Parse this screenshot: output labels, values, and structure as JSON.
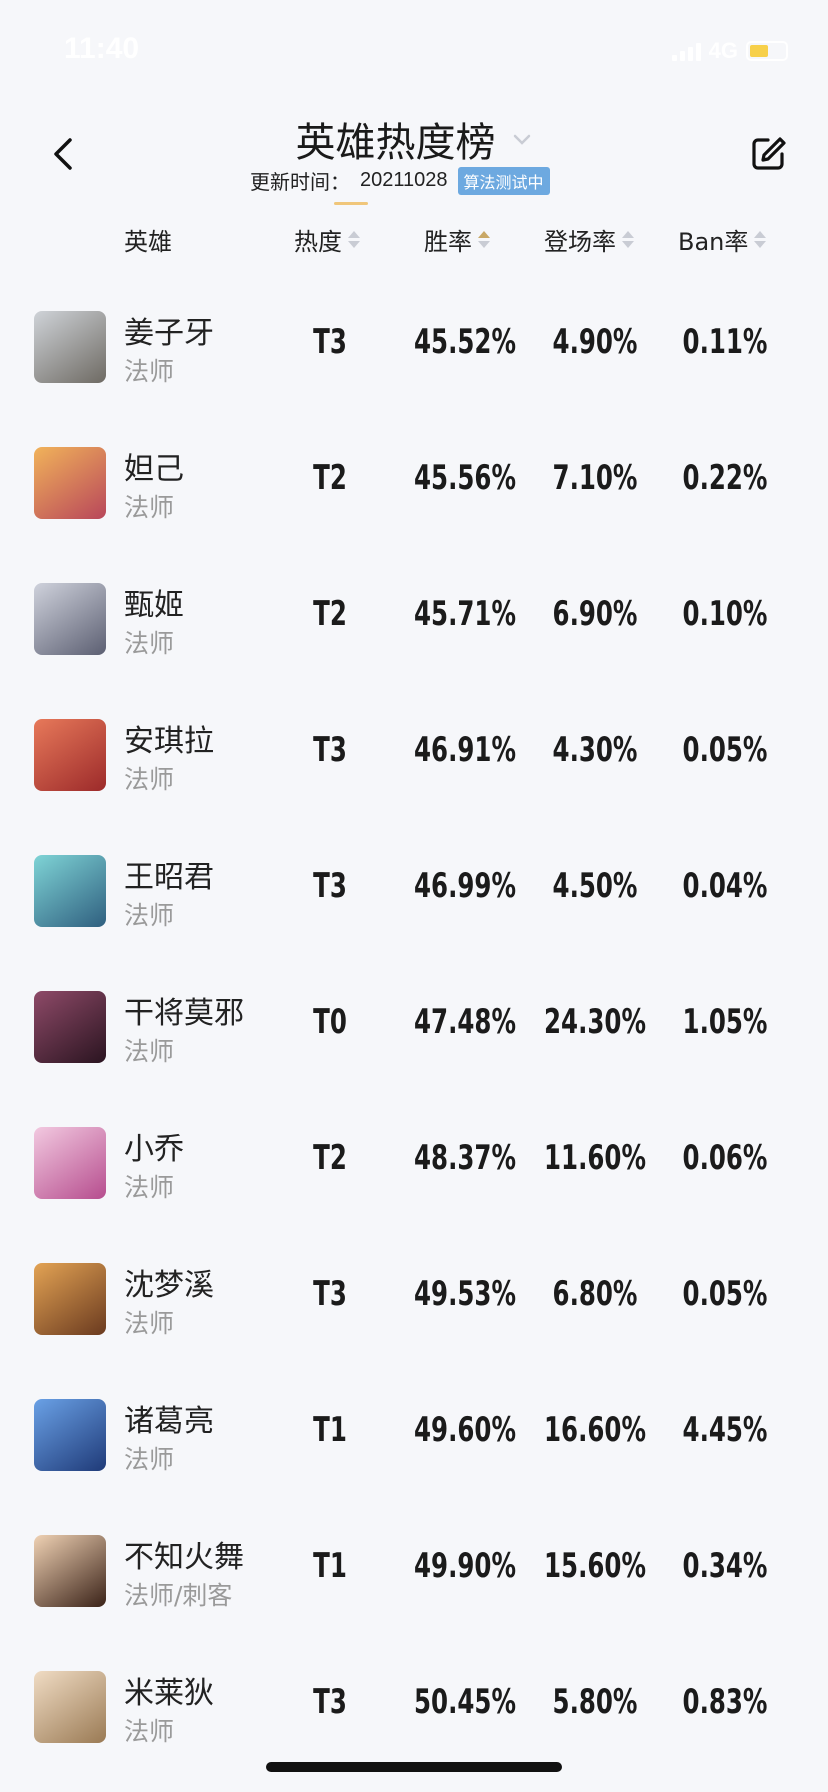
{
  "status_bar": {
    "time": "11:40",
    "network": "4G"
  },
  "nav": {
    "title": "英雄热度榜",
    "update_label": "更新时间：",
    "update_date": "20211028",
    "badge": "算法测试中"
  },
  "columns": {
    "hero": "英雄",
    "heat": "热度",
    "win_rate": "胜率",
    "pick_rate": "登场率",
    "ban_rate": "Ban率"
  },
  "active_sort": "win_rate",
  "heroes": [
    {
      "name": "姜子牙",
      "role": "法师",
      "tier": "T3",
      "win_rate": "45.52%",
      "pick_rate": "4.90%",
      "ban_rate": "0.11%",
      "color_a": "#cfd3d8",
      "color_b": "#6e6a63"
    },
    {
      "name": "妲己",
      "role": "法师",
      "tier": "T2",
      "win_rate": "45.56%",
      "pick_rate": "7.10%",
      "ban_rate": "0.22%",
      "color_a": "#f1b35a",
      "color_b": "#b8465a"
    },
    {
      "name": "甄姬",
      "role": "法师",
      "tier": "T2",
      "win_rate": "45.71%",
      "pick_rate": "6.90%",
      "ban_rate": "0.10%",
      "color_a": "#cfd2dc",
      "color_b": "#5c5f72"
    },
    {
      "name": "安琪拉",
      "role": "法师",
      "tier": "T3",
      "win_rate": "46.91%",
      "pick_rate": "4.30%",
      "ban_rate": "0.05%",
      "color_a": "#e7795a",
      "color_b": "#9c2a2a"
    },
    {
      "name": "王昭君",
      "role": "法师",
      "tier": "T3",
      "win_rate": "46.99%",
      "pick_rate": "4.50%",
      "ban_rate": "0.04%",
      "color_a": "#7fd4d6",
      "color_b": "#2f5f7f"
    },
    {
      "name": "干将莫邪",
      "role": "法师",
      "tier": "T0",
      "win_rate": "47.48%",
      "pick_rate": "24.30%",
      "ban_rate": "1.05%",
      "color_a": "#8e4a68",
      "color_b": "#2a1420"
    },
    {
      "name": "小乔",
      "role": "法师",
      "tier": "T2",
      "win_rate": "48.37%",
      "pick_rate": "11.60%",
      "ban_rate": "0.06%",
      "color_a": "#f2c9e0",
      "color_b": "#b64d8e"
    },
    {
      "name": "沈梦溪",
      "role": "法师",
      "tier": "T3",
      "win_rate": "49.53%",
      "pick_rate": "6.80%",
      "ban_rate": "0.05%",
      "color_a": "#e3a354",
      "color_b": "#6a3a1f"
    },
    {
      "name": "诸葛亮",
      "role": "法师",
      "tier": "T1",
      "win_rate": "49.60%",
      "pick_rate": "16.60%",
      "ban_rate": "4.45%",
      "color_a": "#6aa1e6",
      "color_b": "#1f3a78"
    },
    {
      "name": "不知火舞",
      "role": "法师/刺客",
      "tier": "T1",
      "win_rate": "49.90%",
      "pick_rate": "15.60%",
      "ban_rate": "0.34%",
      "color_a": "#f0d2b4",
      "color_b": "#3a2218"
    },
    {
      "name": "米莱狄",
      "role": "法师",
      "tier": "T3",
      "win_rate": "50.45%",
      "pick_rate": "5.80%",
      "ban_rate": "0.83%",
      "color_a": "#f0dcc4",
      "color_b": "#9a7a54"
    }
  ],
  "colors": {
    "accent_sort": "#c9a866",
    "badge": "#6da9e0",
    "underline": "#f0c67a"
  }
}
